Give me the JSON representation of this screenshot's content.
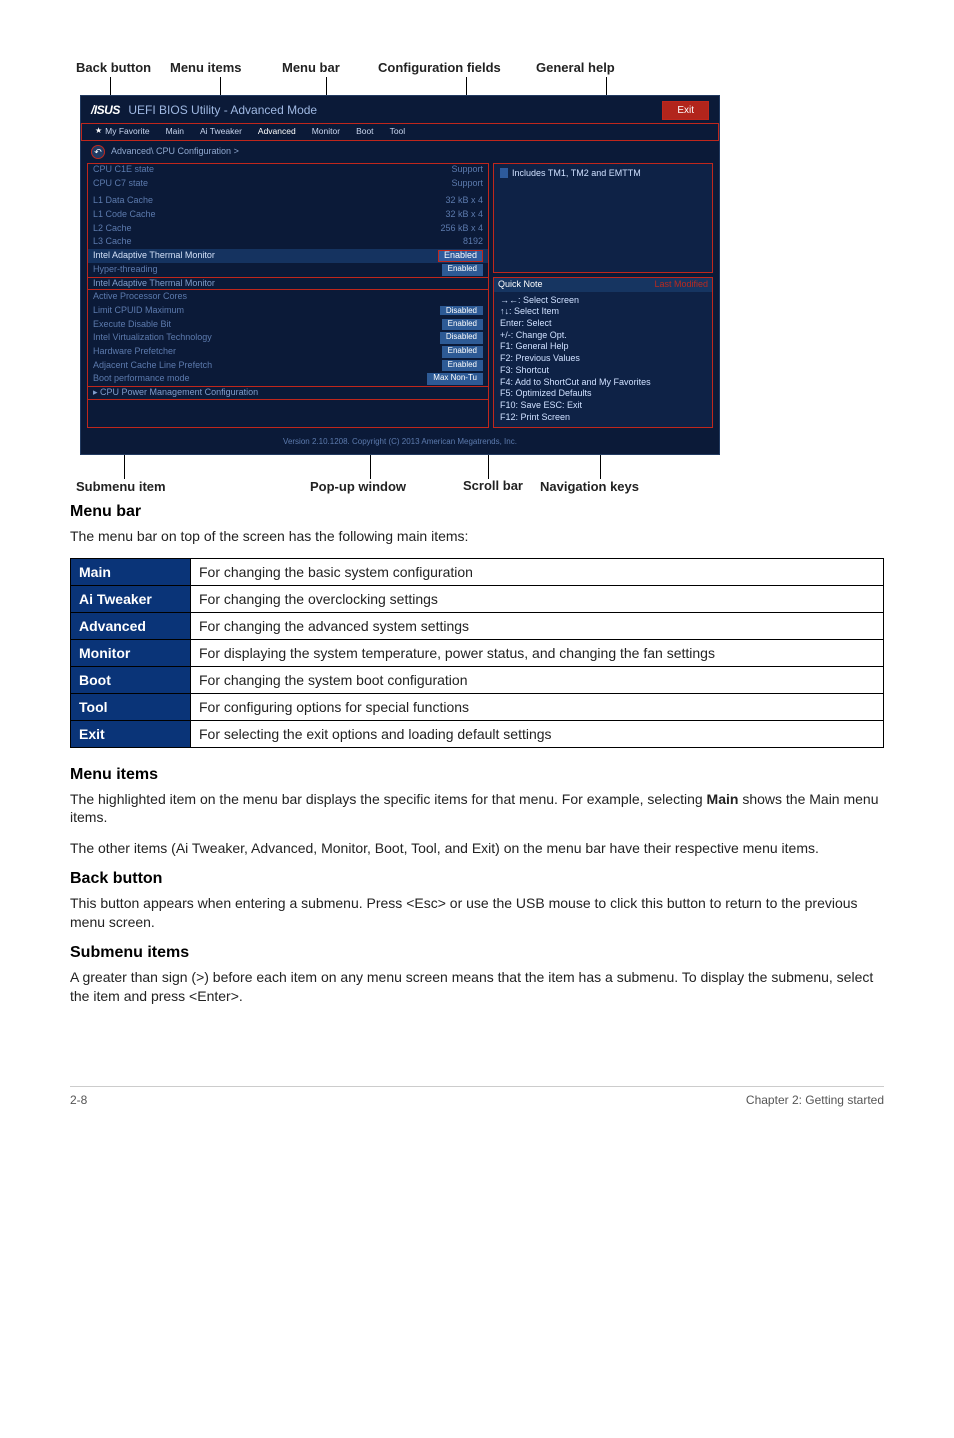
{
  "top_labels": {
    "back_button": "Back button",
    "menu_items": "Menu items",
    "menu_bar": "Menu bar",
    "config_fields": "Configuration fields",
    "general_help": "General help"
  },
  "bios": {
    "logo": "/ISUS",
    "title": "UEFI BIOS Utility - Advanced Mode",
    "exit": "Exit",
    "menubar": {
      "fav": "My Favorite",
      "main": "Main",
      "tweak": "Ai Tweaker",
      "adv": "Advanced",
      "mon": "Monitor",
      "boot": "Boot",
      "tool": "Tool"
    },
    "breadcrumb": "Advanced\\ CPU Configuration >",
    "rows": {
      "c1e": "CPU C1E state",
      "c1e_v": "Support",
      "c7": "CPU C7 state",
      "c7_v": "Support",
      "l1d": "L1 Data Cache",
      "l1d_v": "32 kB x 4",
      "l1c": "L1 Code Cache",
      "l1c_v": "32 kB x 4",
      "l2": "L2 Cache",
      "l2_v": "256 kB x 4",
      "l3": "L3 Cache",
      "l3_v": "8192",
      "iatm": "Intel Adaptive Thermal Monitor",
      "iatm_v": "Enabled",
      "ht": "Hyper-threading",
      "ht_v": "Enabled",
      "ht_sub": "Intel Adaptive Thermal Monitor",
      "apc": "Active Processor Cores",
      "lcm": "Limit CPUID Maximum",
      "lcm_v1": "Disabled",
      "lcm_v2": "Enabled",
      "exd": "Execute Disable Bit",
      "ivt": "Intel Virtualization Technology",
      "ivt_v": "Disabled",
      "hpf": "Hardware Prefetcher",
      "hpf_v": "Enabled",
      "acl": "Adjacent Cache Line Prefetch",
      "acl_v": "Enabled",
      "bpm": "Boot performance mode",
      "bpm_v": "Max Non-Tu",
      "cpm": "CPU Power Management Configuration"
    },
    "help_text": "Includes TM1, TM2 and EMTTM",
    "nav_hdr_l": "Quick Note",
    "nav_hdr_r": "Last Modified",
    "nav": {
      "l1": "→←: Select Screen",
      "l2": "↑↓: Select Item",
      "l3": "Enter: Select",
      "l4": "+/-: Change Opt.",
      "l5": "F1: General Help",
      "l6": "F2: Previous Values",
      "l7": "F3: Shortcut",
      "l8": "F4: Add to ShortCut and My Favorites",
      "l9": "F5: Optimized Defaults",
      "l10": "F10: Save  ESC: Exit",
      "l11": "F12: Print Screen"
    },
    "version": "Version 2.10.1208. Copyright (C) 2013 American Megatrends, Inc."
  },
  "bottom_labels": {
    "submenu": "Submenu item",
    "popup": "Pop-up window",
    "scroll": "Scroll bar",
    "nav": "Navigation keys"
  },
  "sections": {
    "menubar_h": "Menu bar",
    "menubar_p": "The menu bar on top of the screen has the following main items:",
    "menuitems_h": "Menu items",
    "menuitems_p1": "The highlighted item on the menu bar displays the specific items for that menu. For example, selecting Main shows the Main menu items.",
    "menuitems_p1a": "The highlighted item on the menu bar displays the specific items for that menu. For example, selecting ",
    "menuitems_p1b": "Main",
    "menuitems_p1c": " shows the Main menu items.",
    "menuitems_p2": "The other items (Ai Tweaker, Advanced, Monitor, Boot, Tool, and Exit) on the menu bar have their respective menu items.",
    "back_h": "Back button",
    "back_p": "This button appears when entering a submenu. Press <Esc> or use the USB mouse to click this button to return to the previous menu screen.",
    "sub_h": "Submenu items",
    "sub_p": "A greater than sign (>) before each item on any menu screen means that the item has a submenu. To display the submenu, select the item and press <Enter>."
  },
  "table": {
    "main_l": "Main",
    "main_d": "For changing the basic system configuration",
    "ai_l": "Ai Tweaker",
    "ai_d": "For changing the overclocking settings",
    "adv_l": "Advanced",
    "adv_d": "For changing the advanced system settings",
    "mon_l": "Monitor",
    "mon_d": "For displaying the system temperature, power status, and changing the fan settings",
    "boot_l": "Boot",
    "boot_d": "For changing the system boot configuration",
    "tool_l": "Tool",
    "tool_d": "For configuring options for special functions",
    "exit_l": "Exit",
    "exit_d": "For selecting the exit options and loading default settings"
  },
  "footer": {
    "page": "2-8",
    "chapter": "Chapter 2: Getting started"
  }
}
